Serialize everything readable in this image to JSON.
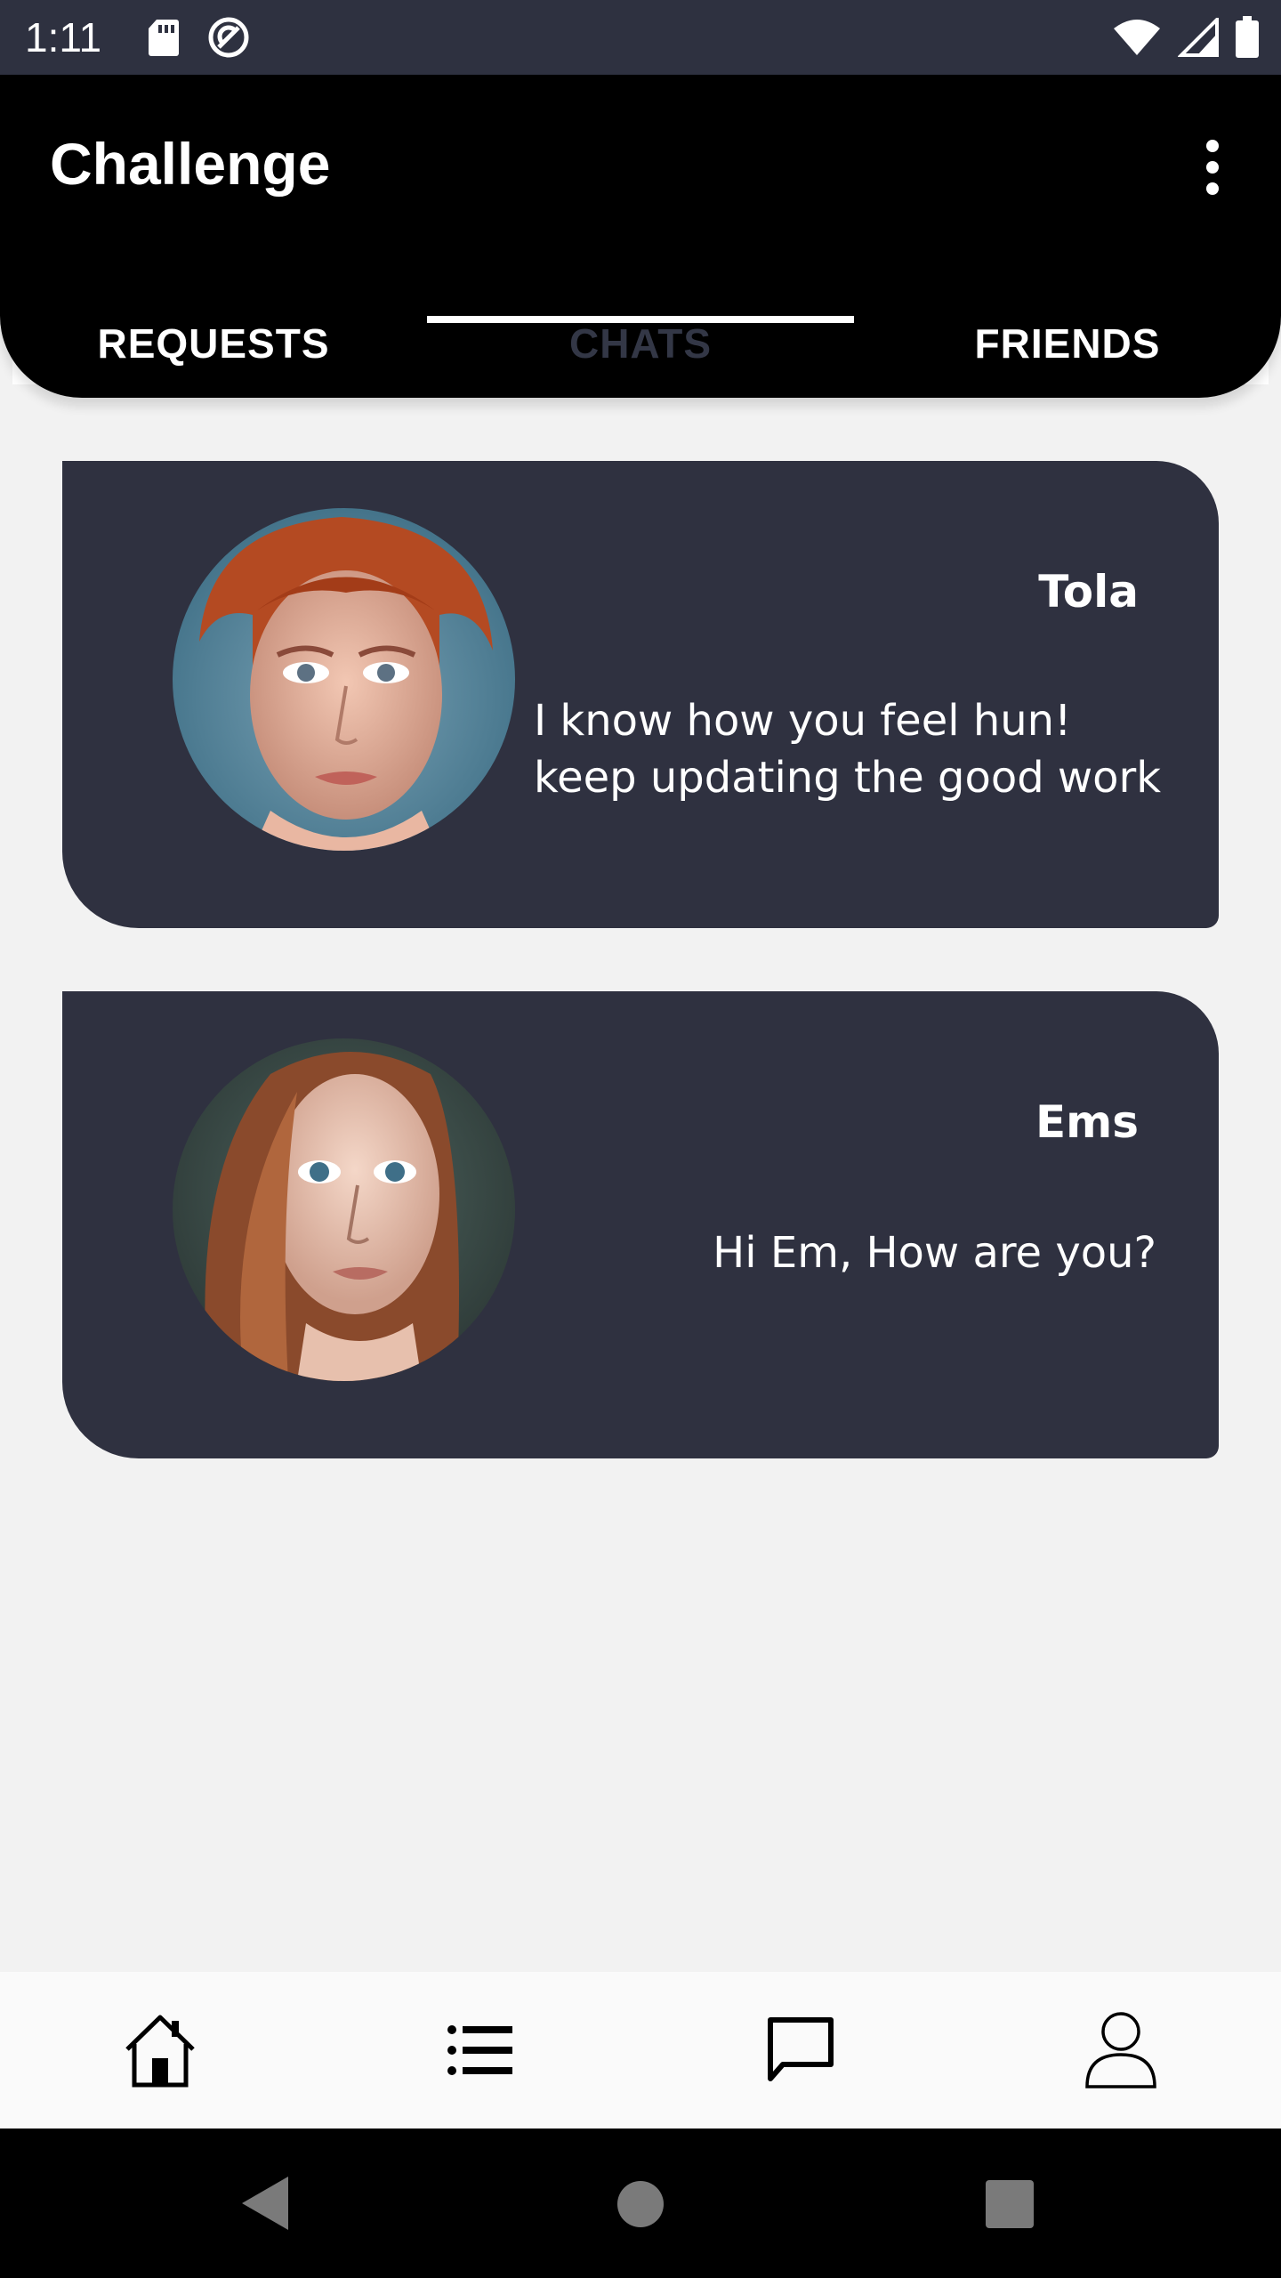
{
  "status_bar": {
    "time": "1:11",
    "left_icons": [
      "sd-card-icon",
      "sync-icon"
    ],
    "right_icons": [
      "wifi-icon",
      "signal-icon",
      "battery-icon"
    ]
  },
  "app_bar": {
    "title": "Challenge",
    "menu_icon": "more-vert-icon",
    "tabs": [
      {
        "label": "REQUESTS",
        "active": false
      },
      {
        "label": "CHATS",
        "active": true
      },
      {
        "label": "FRIENDS",
        "active": false
      }
    ]
  },
  "chats": [
    {
      "name": "Tola",
      "message": "I know how you feel hun! keep updating the good work"
    },
    {
      "name": "Ems",
      "message": "Hi Em, How are you?"
    }
  ],
  "bottom_nav": {
    "items": [
      "home-icon",
      "list-icon",
      "chat-icon",
      "person-icon"
    ],
    "active": "chat-icon"
  },
  "system_nav": {
    "buttons": [
      "back-icon",
      "home-circle-icon",
      "recents-icon"
    ]
  },
  "colors": {
    "status_bar": "#2e3140",
    "app_bar": "#000000",
    "card": "#2f3140",
    "background": "#f2f2f2",
    "inactive_tab_text": "#333746"
  }
}
